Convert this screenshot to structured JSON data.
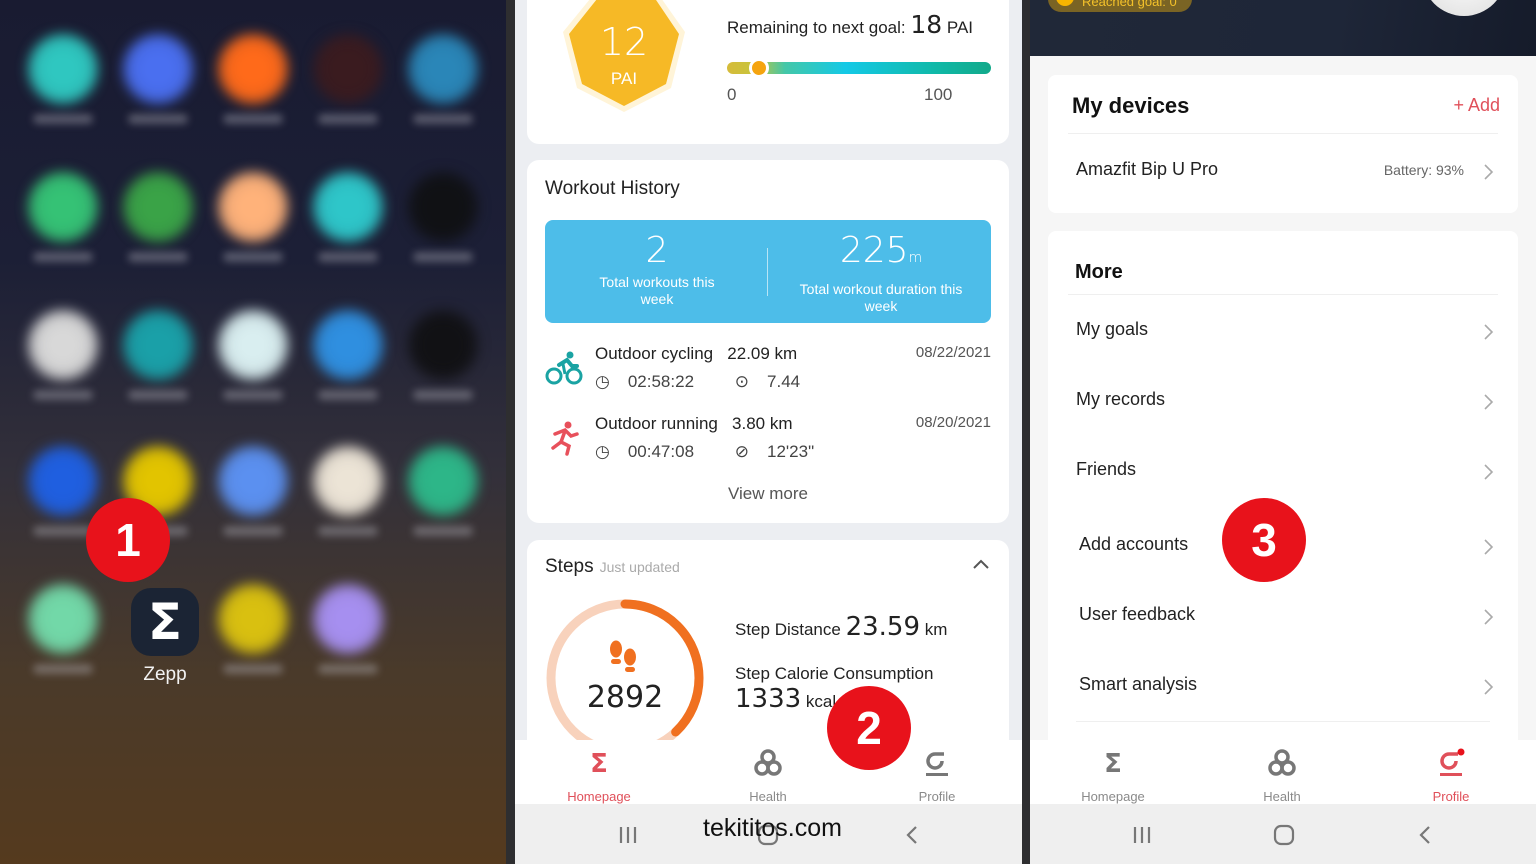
{
  "annotations": {
    "step1": "1",
    "step2": "2",
    "step3": "3"
  },
  "home_screen": {
    "highlighted_app": {
      "label": "Zepp",
      "icon": "sigma-icon"
    },
    "blurred_apps": [
      {
        "color": "#2fc7c0"
      },
      {
        "color": "#4a6ff0"
      },
      {
        "color": "#ff6a1a"
      },
      {
        "color": "#3a1b1f"
      },
      {
        "color": "#2a86b8"
      },
      {
        "color": "#35c275"
      },
      {
        "color": "#3aa347"
      },
      {
        "color": "#ffb27a"
      },
      {
        "color": "#2ec6c9"
      },
      {
        "color": "#101114"
      },
      {
        "color": "#d8d8d8"
      },
      {
        "color": "#1aa0a8"
      },
      {
        "color": "#d9eef0"
      },
      {
        "color": "#2f8fe0"
      },
      {
        "color": "#111114"
      },
      {
        "color": "#1f5fe0"
      },
      {
        "color": "#e2c400"
      },
      {
        "color": "#5b90f0"
      },
      {
        "color": "#ece4d6"
      },
      {
        "color": "#2db688"
      },
      {
        "color": "#72d8a8"
      },
      null,
      {
        "color": "#d9c010"
      },
      {
        "color": "#a68ff0"
      }
    ]
  },
  "homepage": {
    "pai": {
      "value": "12",
      "unit": "PAI",
      "remaining_label": "Remaining to next goal:",
      "remaining_value": "18",
      "remaining_unit": "PAI",
      "scale_min": "0",
      "scale_max": "100",
      "progress_fraction": 0.12
    },
    "workout_history": {
      "title": "Workout History",
      "total_workouts": "2",
      "total_workouts_label": "Total workouts this week",
      "total_duration": "225",
      "total_duration_unit": "m",
      "total_duration_label": "Total workout duration this week",
      "items": [
        {
          "icon": "cycling-icon",
          "name": "Outdoor cycling",
          "distance": "22.09 km",
          "date": "08/22/2021",
          "duration": "02:58:22",
          "metric_icon": "speed-icon",
          "metric": "7.44",
          "color": "#1aa3a3"
        },
        {
          "icon": "running-icon",
          "name": "Outdoor running",
          "distance": "3.80 km",
          "date": "08/20/2021",
          "duration": "00:47:08",
          "metric_icon": "pace-icon",
          "metric": "12'23\"",
          "color": "#e8505b"
        }
      ],
      "view_more": "View more"
    },
    "steps": {
      "title": "Steps",
      "subtitle": "Just updated",
      "count": "2892",
      "ring_progress_fraction_estimated": 0.38,
      "distance_label": "Step Distance",
      "distance_value": "23.59",
      "distance_unit": "km",
      "calorie_label": "Step Calorie Consumption",
      "calorie_value": "1333",
      "calorie_unit": "kcal"
    },
    "tabs": [
      {
        "label": "Homepage",
        "icon": "sigma-icon",
        "active": true
      },
      {
        "label": "Health",
        "icon": "health-icon",
        "active": false
      },
      {
        "label": "Profile",
        "icon": "profile-icon",
        "active": false
      }
    ],
    "watermark": "tekititos.com"
  },
  "profile": {
    "goal_pill": "Reached goal: 0",
    "devices": {
      "title": "My devices",
      "add_label": "+ Add",
      "items": [
        {
          "name": "Amazfit Bip U Pro",
          "battery": "Battery: 93%"
        }
      ]
    },
    "more": {
      "title": "More",
      "items": [
        {
          "label": "My goals"
        },
        {
          "label": "My records"
        },
        {
          "label": "Friends"
        },
        {
          "label": "Add accounts"
        },
        {
          "label": "User feedback"
        },
        {
          "label": "Smart analysis"
        }
      ]
    },
    "tabs": [
      {
        "label": "Homepage",
        "icon": "sigma-icon",
        "active": false
      },
      {
        "label": "Health",
        "icon": "health-icon",
        "active": false
      },
      {
        "label": "Profile",
        "icon": "profile-icon",
        "active": true
      }
    ]
  },
  "colors": {
    "accent_red": "#e0505a",
    "badge_red": "#e8121b",
    "pai_yellow": "#f6b926",
    "summary_blue": "#4dbde9",
    "steps_orange": "#f07020",
    "steps_track": "#f8d2bc"
  }
}
